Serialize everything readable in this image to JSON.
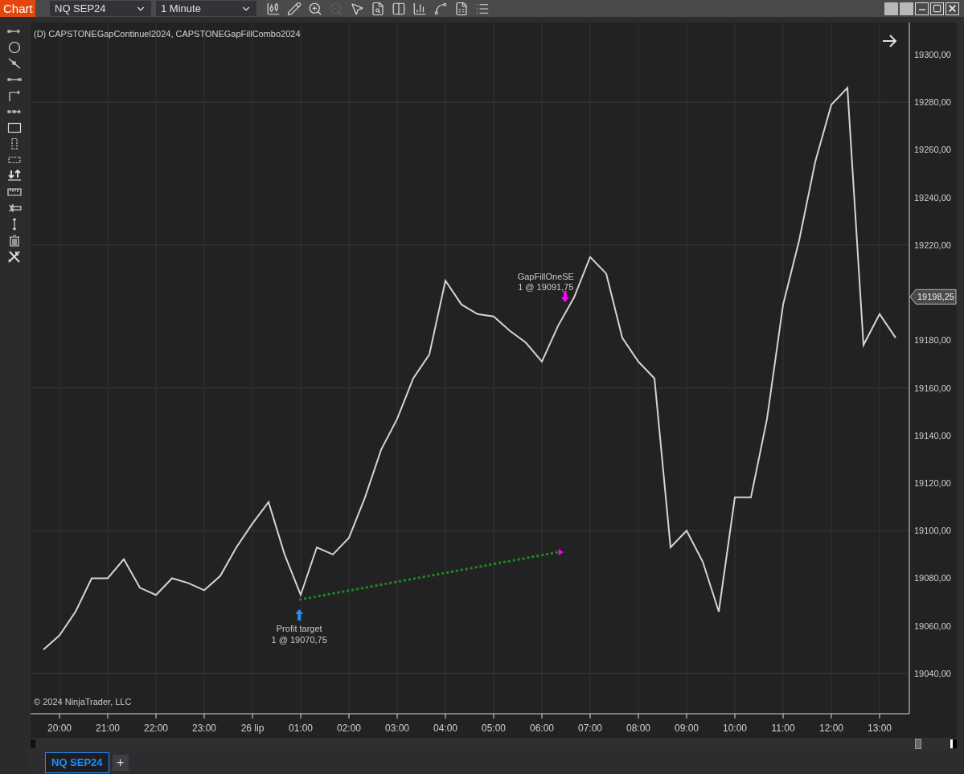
{
  "window": {
    "title": "Chart"
  },
  "toolbar": {
    "instrument": "NQ SEP24",
    "interval": "1 Minute",
    "zoom_out": {
      "disabled": true
    }
  },
  "chart": {
    "legend": "(D) CAPSTONEGapContinuel2024, CAPSTONEGapFillCombo2024",
    "copyright": "© 2024 NinjaTrader, LLC",
    "last_price": "19198,25",
    "markers": [
      {
        "kind": "sell",
        "color": "#ff00ff",
        "text": "GapFillOneSE",
        "detail": "1 @ 19091,75"
      },
      {
        "kind": "buy",
        "color": "#1e90ff",
        "text": "Profit target",
        "detail": "1 @ 19070,75"
      },
      {
        "kind": "link",
        "color": "#1f8a1f"
      }
    ],
    "chart_data": {
      "type": "line",
      "grid": true,
      "ylim": [
        19023.1,
        19313.5
      ],
      "categories": [
        null,
        "20:00",
        null,
        null,
        "21:00",
        null,
        null,
        "22:00",
        null,
        null,
        "23:00",
        null,
        null,
        "26 lip",
        null,
        null,
        "01:00",
        null,
        null,
        "02:00",
        null,
        null,
        "03:00",
        null,
        null,
        "04:00",
        null,
        null,
        "05:00",
        null,
        null,
        "06:00",
        null,
        null,
        "07:00",
        null,
        null,
        "08:00",
        null,
        null,
        "09:00",
        null,
        null,
        "10:00",
        null,
        null,
        "11:00",
        null,
        null,
        "12:00",
        null,
        null,
        "13:00",
        null
      ],
      "values": [
        19050,
        19056,
        19066,
        19080,
        19080,
        19088,
        19076,
        19073,
        19080,
        19078,
        19075,
        19081,
        19093,
        19103,
        19112,
        19090,
        19073,
        19093,
        19090,
        19097,
        19114,
        19134,
        19147,
        19164,
        19174,
        19205,
        19195,
        19191,
        19190,
        19184,
        19179,
        19171,
        19186,
        19198,
        19215,
        19208,
        19181,
        19171,
        19164,
        19093,
        19100,
        19087,
        19066,
        19114,
        19114,
        19147,
        19195,
        19222,
        19255,
        19279,
        19286,
        19178,
        19191,
        19181
      ],
      "yticks": [
        {
          "value": 19040,
          "label": "19040,00"
        },
        {
          "value": 19060,
          "label": "19060,00"
        },
        {
          "value": 19080,
          "label": "19080,00"
        },
        {
          "value": 19100,
          "label": "19100,00"
        },
        {
          "value": 19120,
          "label": "19120,00"
        },
        {
          "value": 19140,
          "label": "19140,00"
        },
        {
          "value": 19160,
          "label": "19160,00"
        },
        {
          "value": 19180,
          "label": "19180,00"
        },
        {
          "value": 19220,
          "label": "19220,00"
        },
        {
          "value": 19240,
          "label": "19240,00"
        },
        {
          "value": 19260,
          "label": "19260,00"
        },
        {
          "value": 19280,
          "label": "19280,00"
        },
        {
          "value": 19300,
          "label": "19300,00"
        }
      ]
    }
  },
  "tabs": [
    {
      "label": "NQ SEP24",
      "selected": true
    }
  ],
  "add_tab": "+"
}
